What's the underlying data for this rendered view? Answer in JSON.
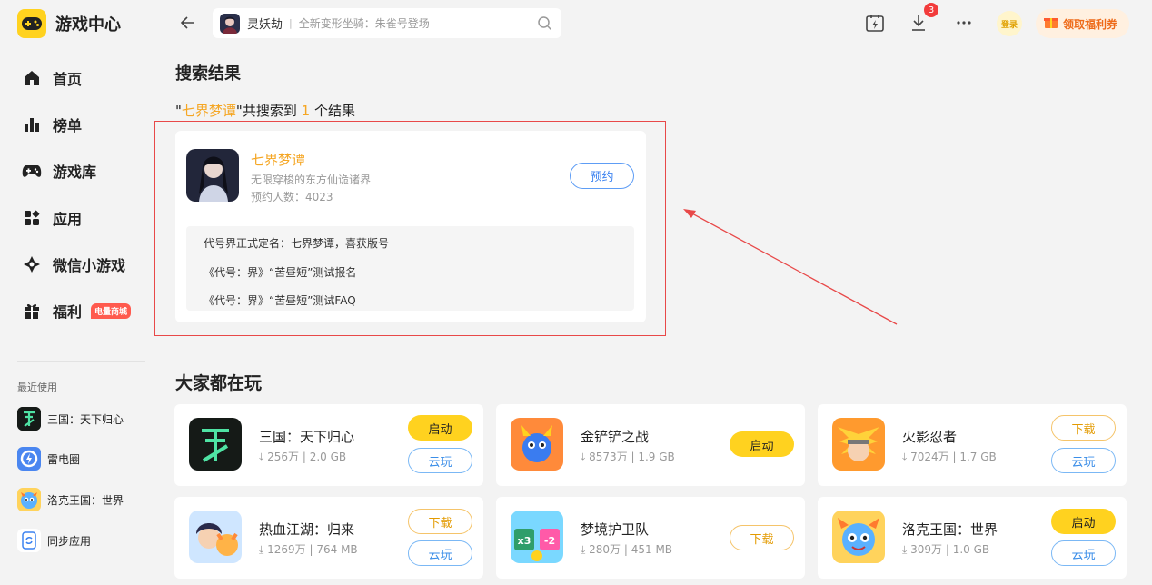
{
  "app": {
    "title": "游戏中心"
  },
  "sidebar": {
    "nav": [
      {
        "label": "首页",
        "icon": "home-icon"
      },
      {
        "label": "榜单",
        "icon": "ranking-icon"
      },
      {
        "label": "游戏库",
        "icon": "gamepad-icon"
      },
      {
        "label": "应用",
        "icon": "apps-icon"
      },
      {
        "label": "微信小游戏",
        "icon": "mini-game-icon"
      },
      {
        "label": "福利",
        "icon": "gift-icon",
        "badge": "电量商城"
      }
    ],
    "recent_title": "最近使用",
    "recent": [
      {
        "label": "三国：天下归心"
      },
      {
        "label": "雷电圈"
      },
      {
        "label": "洛克王国：世界"
      },
      {
        "label": "同步应用"
      }
    ]
  },
  "topbar": {
    "search_game": "灵妖劫",
    "search_text": "全新变形坐骑：朱雀号登场",
    "download_badge": "3",
    "login_label": "登录",
    "welfare_label": "领取福利券"
  },
  "search": {
    "section_title": "搜索结果",
    "summary": {
      "q_open": "\"",
      "query": "七界梦谭",
      "q_close": "\"",
      "mid": "共搜索到",
      "count": "1",
      "end": "个结果"
    },
    "result": {
      "name": "七界梦谭",
      "desc": "无限穿梭的东方仙诡诸界",
      "count_text": "预约人数：4023",
      "button": "预约",
      "news": [
        "代号界正式定名：七界梦谭，喜获版号",
        "《代号：界》“苦昼短”测试报名",
        "《代号：界》“苦昼短”测试FAQ"
      ]
    }
  },
  "popular": {
    "section_title": "大家都在玩",
    "cloud_label": "云玩",
    "games": [
      {
        "name": "三国：天下归心",
        "downloads": "256万",
        "size": "2.0 GB",
        "action": "启动",
        "cloud": true
      },
      {
        "name": "金铲铲之战",
        "downloads": "8573万",
        "size": "1.9 GB",
        "action": "启动",
        "cloud": false
      },
      {
        "name": "火影忍者",
        "downloads": "7024万",
        "size": "1.7 GB",
        "action": "下载",
        "cloud": true
      },
      {
        "name": "热血江湖：归来",
        "downloads": "1269万",
        "size": "764 MB",
        "action": "下载",
        "cloud": true
      },
      {
        "name": "梦境护卫队",
        "downloads": "280万",
        "size": "451 MB",
        "action": "下载",
        "cloud": false
      },
      {
        "name": "洛克王国：世界",
        "downloads": "309万",
        "size": "1.0 GB",
        "action": "启动",
        "cloud": true
      }
    ]
  },
  "colors": {
    "accent_yellow": "#ffd21f",
    "highlight_orange": "#f5a623",
    "link_blue": "#3b82f0",
    "annotation_red": "#e84848"
  }
}
